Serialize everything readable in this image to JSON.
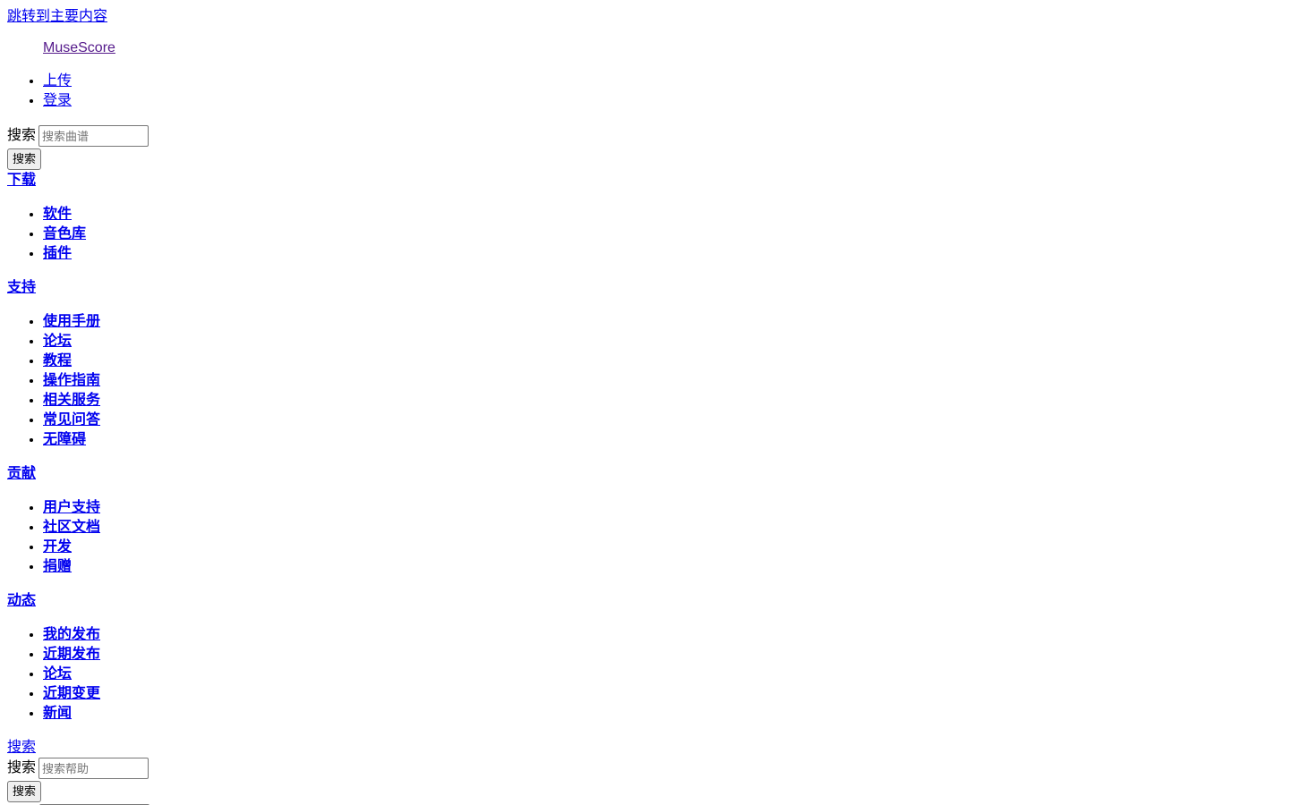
{
  "skip_link": "跳转到主要内容",
  "brand": "MuseScore",
  "top_nav": [
    {
      "label": "上传"
    },
    {
      "label": "登录"
    }
  ],
  "site_search": {
    "label": "搜索",
    "placeholder": "搜索曲谱",
    "button": "搜索"
  },
  "sections": [
    {
      "title": "下载",
      "items": [
        "软件",
        "音色库",
        "插件"
      ]
    },
    {
      "title": "支持",
      "items": [
        "使用手册",
        "论坛",
        "教程",
        "操作指南",
        "相关服务",
        "常见问答",
        "无障碍"
      ]
    },
    {
      "title": "贡献",
      "items": [
        "用户支持",
        "社区文档",
        "开发",
        "捐赠"
      ]
    },
    {
      "title": "动态",
      "items": [
        "我的发布",
        "近期发布",
        "论坛",
        "近期变更",
        "新闻"
      ]
    }
  ],
  "help_search": {
    "link": "搜索",
    "label": "搜索",
    "placeholder": "搜索帮助",
    "button": "搜索"
  },
  "colors": {
    "link": "#0000ee",
    "visited_link": "#551a8b",
    "text": "#000000",
    "background": "#ffffff"
  }
}
